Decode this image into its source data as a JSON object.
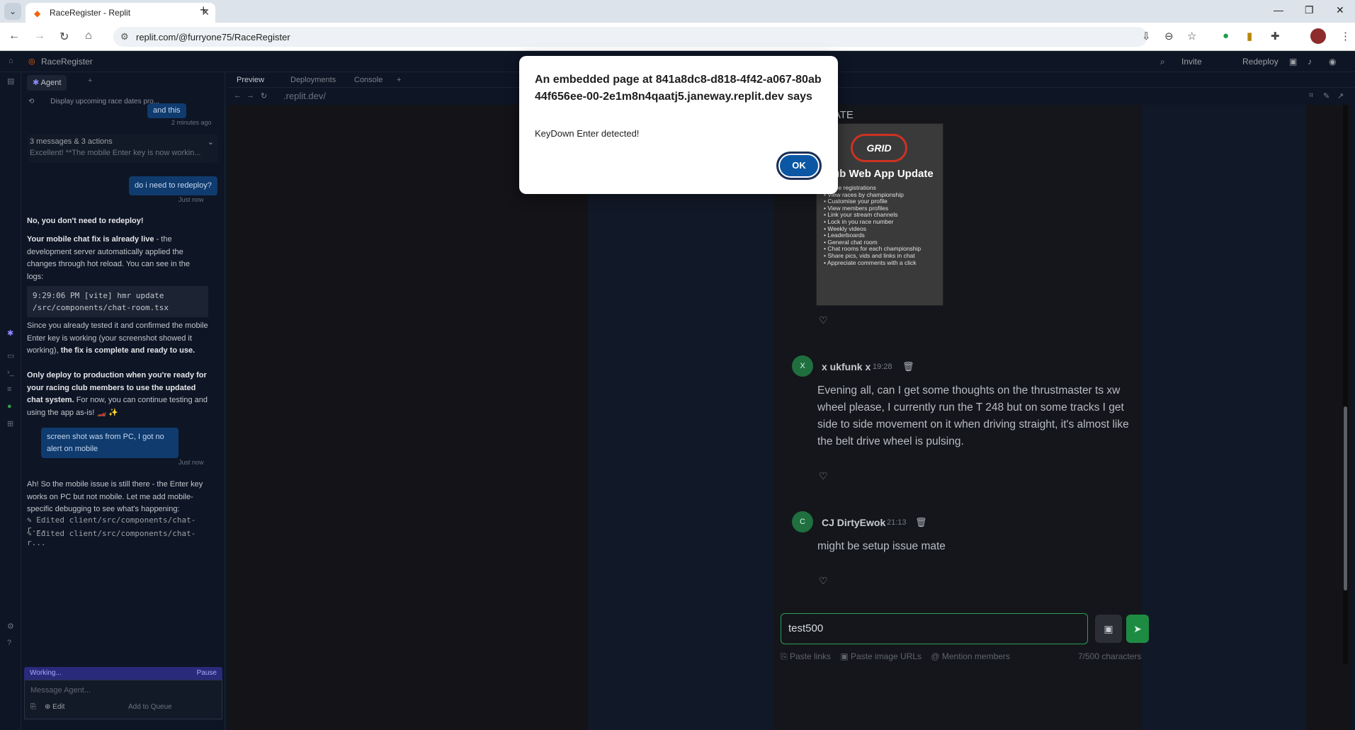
{
  "browser": {
    "tab_title": "RaceRegister - Replit",
    "url": "replit.com/@furryone75/RaceRegister"
  },
  "app": {
    "title": "RaceRegister",
    "invite_label": "Invite",
    "redeploy_label": "Redeploy"
  },
  "agent_panel": {
    "tab_label": "Agent",
    "history_title": "Display upcoming race dates pro...",
    "prev_bubble": "and this",
    "prev_time": "2 minutes ago",
    "group_title": "3 messages & 3 actions",
    "group_preview": "Excellent! **The mobile Enter key is now workin...",
    "user_msg_1": "do i need to redeploy?",
    "user_msg_1_time": "Just now",
    "agent_reply_1": "No, you don't need to redeploy!",
    "agent_reply_2_bold": "Your mobile chat fix is already live",
    "agent_reply_2_rest": " - the development server automatically applied the changes through hot reload. You can see in the logs:",
    "code_line_1": "9:29:06 PM [vite] hmr update",
    "code_line_2": "/src/components/chat-room.tsx",
    "agent_reply_3_a": "Since you already tested it and confirmed the mobile Enter key is working (your screenshot showed it working), ",
    "agent_reply_3_bold": "the fix is complete and ready to use.",
    "agent_reply_4_bold": "Only deploy to production when you're ready for your racing club members to use the updated chat system.",
    "agent_reply_4_rest": " For now, you can continue testing and using the app as-is! 🏎️ ✨",
    "user_msg_2": "screen shot was from PC, I got no alert on mobile",
    "user_msg_2_time": "Just now",
    "agent_reply_5": "Ah! So the mobile issue is still there - the Enter key works on PC but not mobile. Let me add mobile-specific debugging to see what's happening:",
    "edit_1": "Edited client/src/components/chat-r...",
    "edit_2": "Edited client/src/components/chat-r...",
    "working_label": "Working...",
    "pause_label": "Pause",
    "input_placeholder": "Message Agent...",
    "edit_label": "Edit",
    "add_queue_label": "Add to Queue"
  },
  "main_tabs": {
    "preview": "Preview",
    "deployments": "Deployments",
    "console": "Console"
  },
  "preview": {
    "url": ".replit.dev/",
    "update_heading": "DATE",
    "poster_title": "Club Web App Update",
    "poster_items": [
      "• Race registrations",
      "• View races by championship",
      "• Customise your profile",
      "• View members profiles",
      "• Link your stream channels",
      "• Lock in you race number",
      "• Weekly videos",
      "• Leaderboards",
      "• General chat room",
      "• Chat rooms for each championship",
      "• Share pics, vids and links in chat",
      "• Appreciate comments with a click"
    ],
    "messages": [
      {
        "avatar": "X",
        "author": "x ukfunk x",
        "time": "19:28",
        "body": "Evening all, can I get some thoughts on the thrustmaster ts xw wheel please, I currently run the T 248 but on some tracks I get side to side movement on it when driving straight, it's almost like the belt drive wheel is pulsing."
      },
      {
        "avatar": "C",
        "author": "CJ DirtyEwok",
        "time": "21:13",
        "body": "might be setup issue mate"
      }
    ],
    "chat_input_value": "test500",
    "paste_links": "Paste links",
    "paste_images": "Paste image URLs",
    "mention": "Mention members",
    "char_count": "7/500 characters"
  },
  "dialog": {
    "title": "An embedded page at 841a8dc8-d818-4f42-a067-80ab44f656ee-00-2e1m8n4qaatj5.janeway.replit.dev says",
    "message": "KeyDown Enter detected!",
    "ok_label": "OK"
  },
  "colors": {
    "accent_green": "#1e8b43",
    "dialog_button": "#0b57a4",
    "user_bubble": "#0f3b6e"
  }
}
